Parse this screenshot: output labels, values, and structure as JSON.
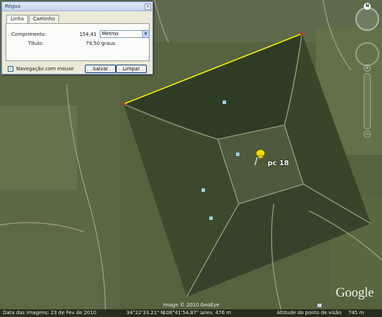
{
  "ruler": {
    "title": "Régua",
    "close_label": "×",
    "tabs": [
      {
        "label": "Linha",
        "active": true
      },
      {
        "label": "Caminho",
        "active": false
      }
    ],
    "length_label": "Comprimento:",
    "length_value": "154,41",
    "unit_selected": "Metros",
    "heading_label": "Título:",
    "heading_value": "79,50 graus",
    "mouse_nav_label": "Navegação com mouse",
    "mouse_nav_checked": true,
    "save_label": "Salvar",
    "clear_label": "Limpar"
  },
  "placemark": {
    "label": "pc 18",
    "icon": "yellow-pushpin-icon"
  },
  "nav": {
    "compass_north": "N"
  },
  "status": {
    "imagery_date": "Data das imagens: 23 de Fev de 2010",
    "lat": "34°22'33.21\" N",
    "lon": "108°41'54.87\" L",
    "elev": "elev. 476 m",
    "eye_alt": "Altitude do ponto de visão",
    "eye_alt_value": "745 m"
  },
  "copyright": "Image © 2010 GeoEye",
  "brand": "Google",
  "colors": {
    "measure_line": "#f2f20a",
    "dialog_bg": "#ece9d8",
    "pin": "#f4e000"
  }
}
